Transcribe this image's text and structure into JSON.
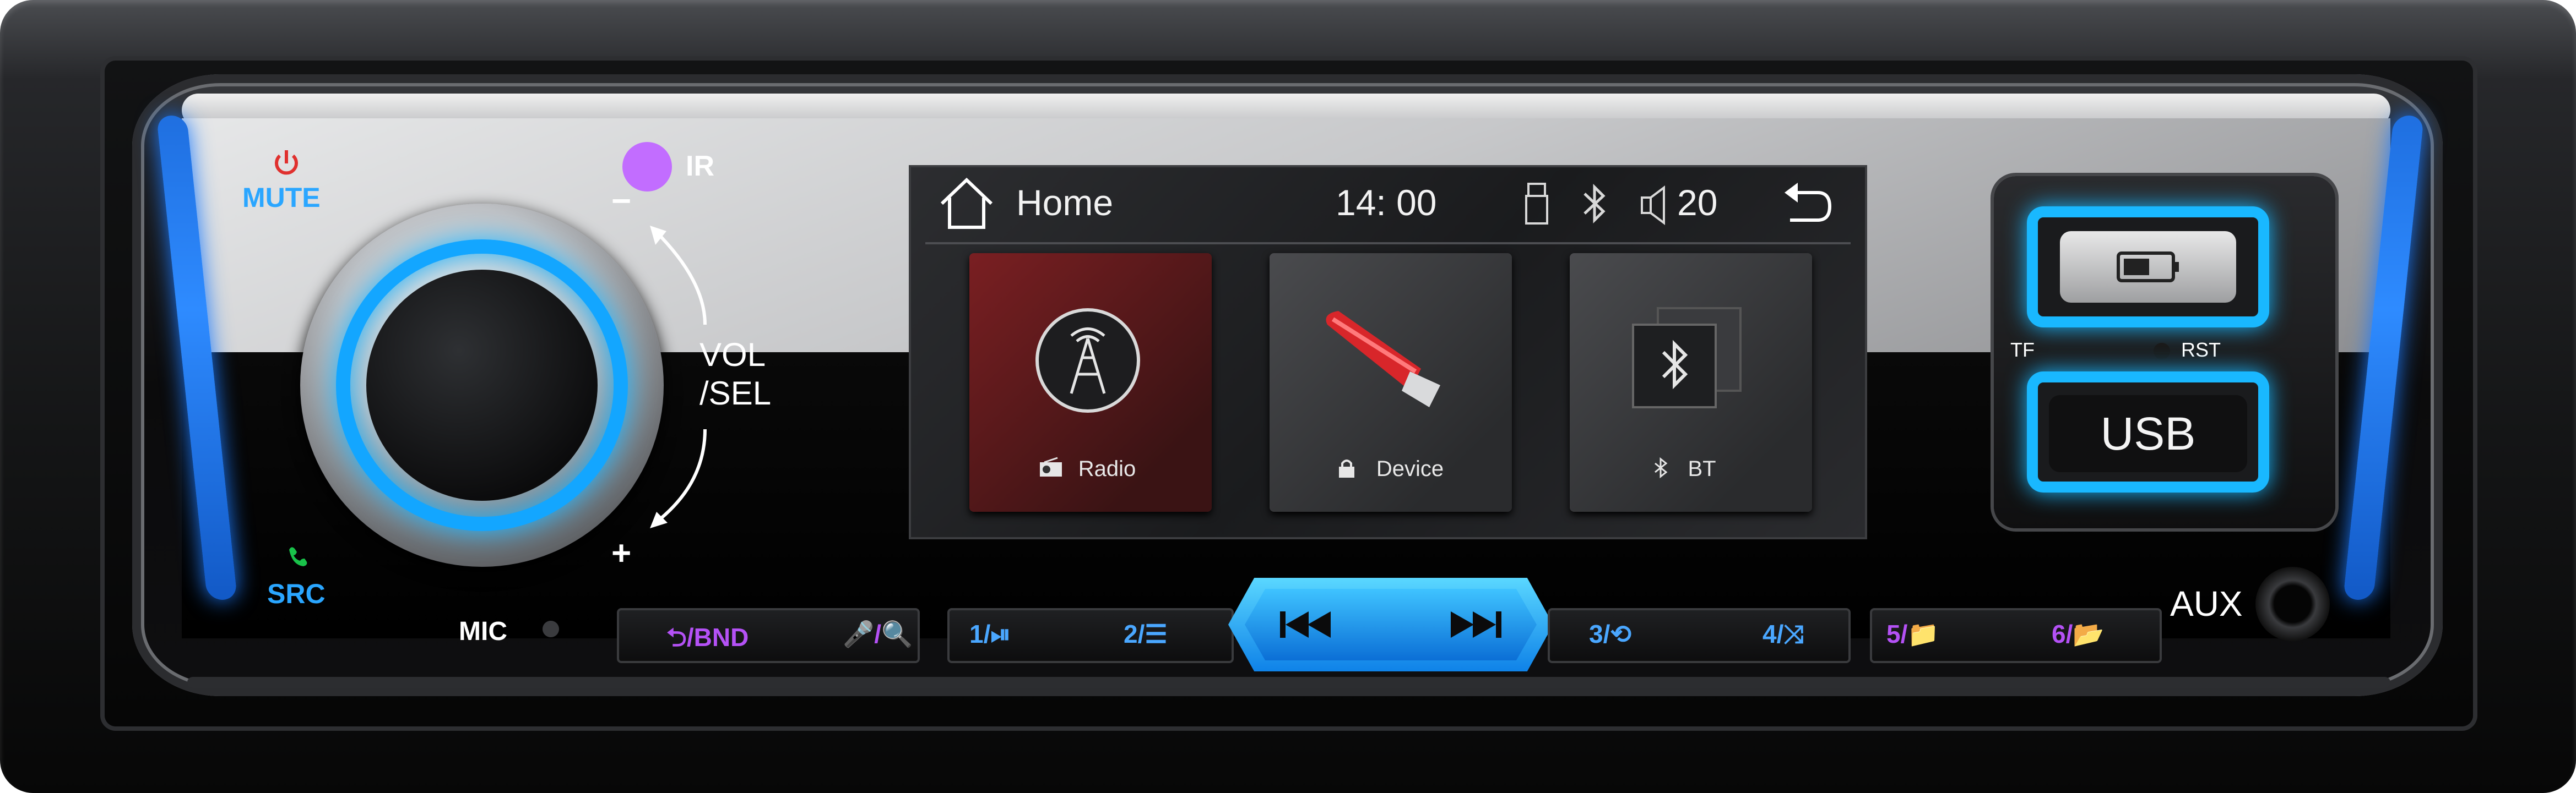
{
  "panel": {
    "mute_label": "MUTE",
    "ir_label": "IR",
    "vol_sel_line1": "VOL",
    "vol_sel_line2": "/SEL",
    "minus": "−",
    "plus": "+",
    "src_label": "SRC",
    "mic_label": "MIC",
    "aux_label": "AUX",
    "tf_label": "TF",
    "rst_label": "RST",
    "usb_label": "USB"
  },
  "screen": {
    "home_label": "Home",
    "time": "14: 00",
    "volume": "20",
    "tiles": [
      {
        "label": "Radio"
      },
      {
        "label": "Device"
      },
      {
        "label": "BT"
      }
    ]
  },
  "buttons": {
    "bnd": "⮌/BND",
    "mic_search": "🎤/🔍",
    "b1": "1/⏯",
    "b2": "2/☰",
    "b3": "3/⟲",
    "b4": "4/⤨",
    "b5": "5/📁",
    "b6": "6/📂"
  },
  "colors": {
    "accent_blue": "#19b8ff",
    "accent_purple": "#b451f5",
    "mute_red": "#e0302e",
    "src_green": "#19c24a"
  }
}
